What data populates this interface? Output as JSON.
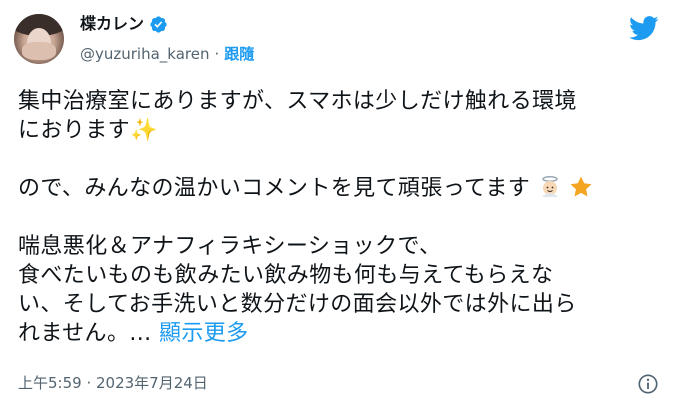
{
  "user": {
    "display_name": "楪カレン",
    "handle": "@yuzuriha_karen",
    "separator": "·",
    "follow_label": "跟隨"
  },
  "tweet": {
    "line1": "集中治療室にありますが、スマホは少しだけ触れる環境",
    "line2": "におります",
    "sparkle": "✨",
    "line3": "ので、みんなの温かいコメントを見て頑張ってます",
    "line4": "喘息悪化＆アナフィラキシーショックで、",
    "line5": "食べたいものも飲みたい飲み物も何も与えてもらえな",
    "line6": "い、そしてお手洗いと数分だけの面会以外では外に出ら",
    "line7": "れません。...",
    "show_more": "顯示更多"
  },
  "meta": {
    "timestamp": "上午5:59 · 2023年7月24日"
  },
  "colors": {
    "accent": "#1d9bf0",
    "muted": "#536471",
    "text": "#0f1419"
  },
  "icons": {
    "verified": "verified-badge-icon",
    "twitter": "twitter-bird-icon",
    "angel": "angel-emoji-icon",
    "star": "star-emoji-icon",
    "info": "info-icon"
  }
}
